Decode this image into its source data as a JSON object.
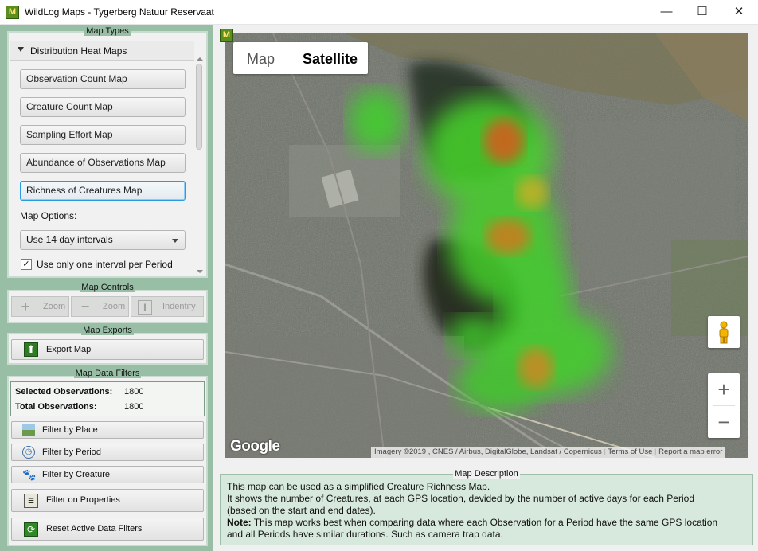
{
  "window": {
    "icon_letter": "M",
    "title": "WildLog Maps - Tygerberg Natuur Reservaat",
    "minimize_glyph": "—",
    "maximize_glyph": "☐",
    "close_glyph": "✕"
  },
  "map_types": {
    "group_title": "Map Types",
    "section_label": "Distribution Heat Maps",
    "buttons": [
      {
        "label": "Observation Count Map",
        "selected": false
      },
      {
        "label": "Creature Count Map",
        "selected": false
      },
      {
        "label": "Sampling Effort Map",
        "selected": false
      },
      {
        "label": "Abundance of Observations Map",
        "selected": false
      },
      {
        "label": "Richness of Creatures Map",
        "selected": true
      }
    ],
    "options_label": "Map Options:",
    "interval_select": "Use 14 day intervals",
    "checkbox_label": "Use only one interval per Period",
    "checkbox_checked": true
  },
  "map_controls": {
    "group_title": "Map Controls",
    "zoom_in_label": "Zoom",
    "zoom_out_label": "Zoom",
    "identify_label": "Indentify"
  },
  "map_exports": {
    "group_title": "Map Exports",
    "export_label": "Export Map"
  },
  "data_filters": {
    "group_title": "Map Data Filters",
    "selected_label": "Selected Observations:",
    "selected_value": "1800",
    "total_label": "Total Observations:",
    "total_value": "1800",
    "filter_place": "Filter by Place",
    "filter_period": "Filter by Period",
    "filter_creature": "Filter by Creature",
    "filter_properties": "Filter on Properties",
    "reset": "Reset Active Data Filters"
  },
  "map": {
    "type_map": "Map",
    "type_satellite": "Satellite",
    "active_type": "Satellite",
    "zoom_in": "+",
    "zoom_out": "−",
    "logo": "Google",
    "attribution": "Imagery ©2019 , CNES / Airbus, DigitalGlobe, Landsat / Copernicus",
    "terms": "Terms of Use",
    "report": "Report a map error"
  },
  "description": {
    "title": "Map Description",
    "line1": "This map can be used as a simplified Creature Richness Map.",
    "line2": "It shows the number of Creatures, at each GPS location, devided by the number of active days for each Period",
    "line3": "(based on the start and end dates).",
    "note_label": "Note:",
    "note_text": " This map works best when comparing data where each Observation for a Period have the same GPS location",
    "line5": "and all Periods have similar durations. Such as camera trap data."
  },
  "colors": {
    "panel_green": "#98bfa6",
    "heat_low": "#3fd12b",
    "heat_high": "#e0551b",
    "selected_border": "#2a9be0"
  }
}
